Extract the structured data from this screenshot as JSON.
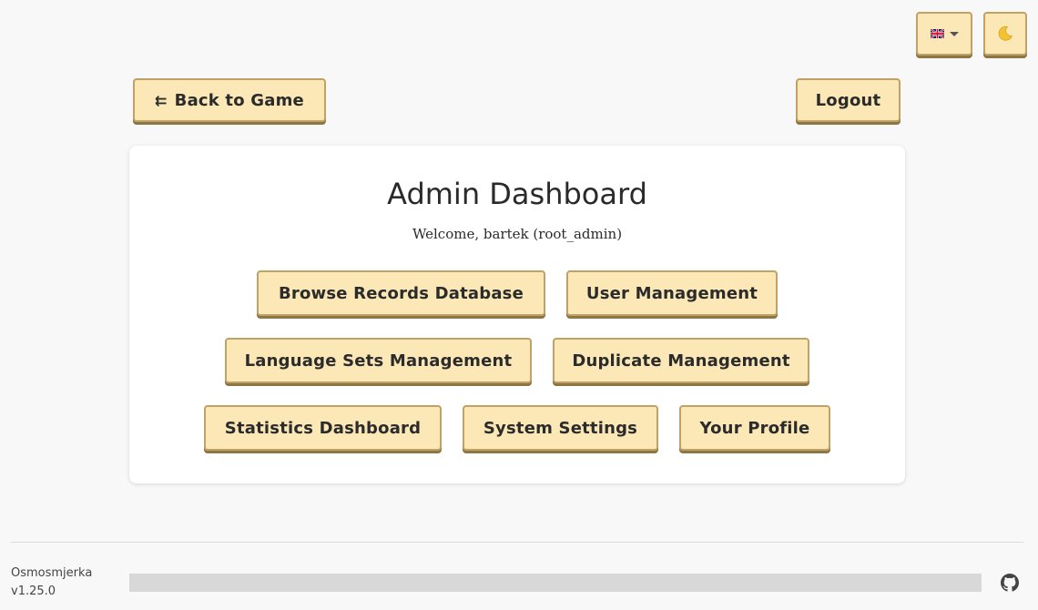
{
  "header": {
    "language": {
      "flag_icon": "uk-flag-icon",
      "caret_icon": "chevron-down-icon"
    },
    "theme_toggle": {
      "icon": "moon-icon"
    }
  },
  "nav": {
    "back_arrow": "⇇",
    "back_label": "Back to Game",
    "logout_label": "Logout"
  },
  "dashboard": {
    "title": "Admin Dashboard",
    "welcome": "Welcome, bartek (root_admin)",
    "buttons": [
      "Browse Records Database",
      "User Management",
      "Language Sets Management",
      "Duplicate Management",
      "Statistics Dashboard",
      "System Settings",
      "Your Profile"
    ]
  },
  "footer": {
    "app_name": "Osmosmjerka",
    "version": "v1.25.0",
    "repo_icon": "github-icon"
  },
  "colors": {
    "button_bg": "#fbe8b6",
    "button_border": "#c1a266",
    "button_shadow": "#8c7644",
    "page_bg": "#f8f8f8",
    "card_bg": "#ffffff"
  }
}
